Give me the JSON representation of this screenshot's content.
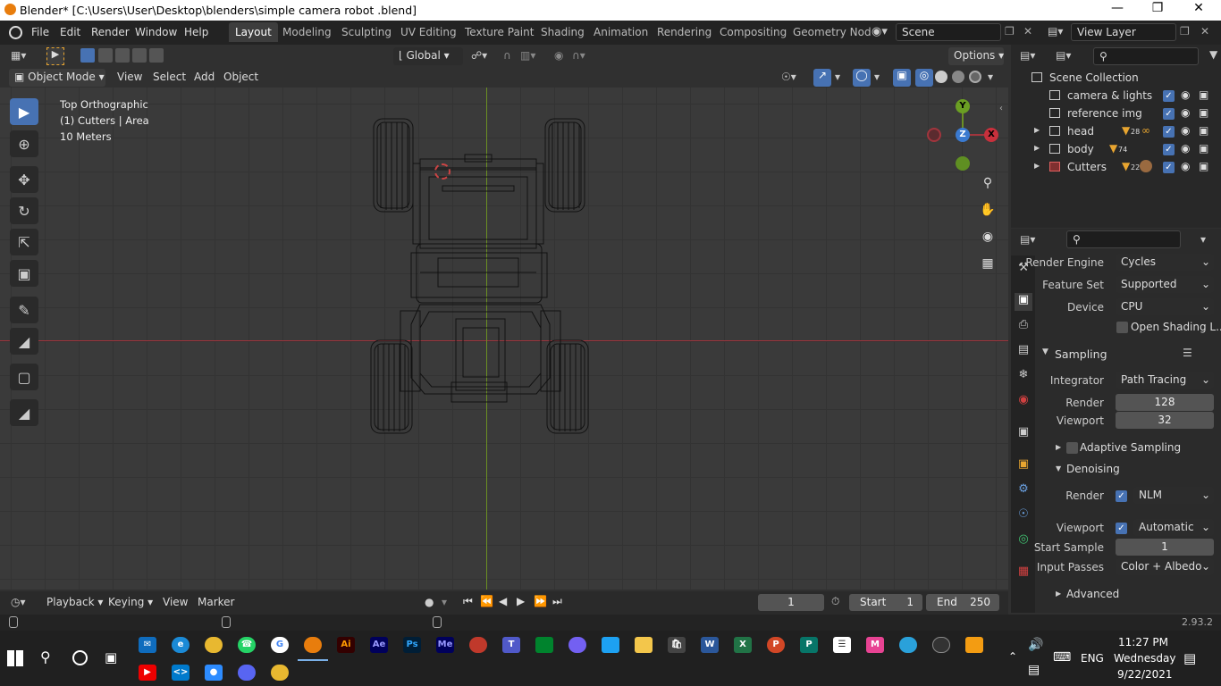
{
  "window": {
    "title": "Blender* [C:\\Users\\User\\Desktop\\blenders\\simple camera robot .blend]"
  },
  "menu": [
    "File",
    "Edit",
    "Render",
    "Window",
    "Help"
  ],
  "workspaces": [
    "Layout",
    "Modeling",
    "Sculpting",
    "UV Editing",
    "Texture Paint",
    "Shading",
    "Animation",
    "Rendering",
    "Compositing",
    "Geometry Nod"
  ],
  "scene": "Scene",
  "view_layer": "View Layer",
  "viewport": {
    "mode": "Object Mode",
    "menus": [
      "View",
      "Select",
      "Add",
      "Object"
    ],
    "orientation": "Global",
    "options": "Options",
    "info": [
      "Top Orthographic",
      "(1) Cutters | Area",
      "10 Meters"
    ],
    "gizmo": {
      "y": "Y",
      "z": "Z",
      "x": "X"
    }
  },
  "outliner": {
    "root": "Scene Collection",
    "items": [
      {
        "name": "camera & lights",
        "count": ""
      },
      {
        "name": "reference img",
        "count": ""
      },
      {
        "name": "head",
        "count": "28"
      },
      {
        "name": "body",
        "count": "74"
      },
      {
        "name": "Cutters",
        "count": "22"
      }
    ]
  },
  "properties": {
    "render_engine_label": "Render Engine",
    "render_engine": "Cycles",
    "feature_set_label": "Feature Set",
    "feature_set": "Supported",
    "device_label": "Device",
    "device": "CPU",
    "osl": "Open Shading L...",
    "sampling": "Sampling",
    "integrator_label": "Integrator",
    "integrator": "Path Tracing",
    "render_label": "Render",
    "render_samples": "128",
    "viewport_label": "Viewport",
    "viewport_samples": "32",
    "adaptive": "Adaptive Sampling",
    "denoising": "Denoising",
    "den_render_label": "Render",
    "den_render": "NLM",
    "den_viewport_label": "Viewport",
    "den_viewport": "Automatic",
    "start_sample_label": "Start Sample",
    "start_sample": "1",
    "input_passes_label": "Input Passes",
    "input_passes": "Color + Albedo",
    "advanced": "Advanced"
  },
  "timeline": {
    "menus": [
      "Playback",
      "Keying",
      "View",
      "Marker"
    ],
    "frame": "1",
    "start_label": "Start",
    "start": "1",
    "end_label": "End",
    "end": "250"
  },
  "status": {
    "version": "2.93.2"
  },
  "taskbar": {
    "time": "11:27 PM",
    "day": "Wednesday",
    "date": "9/22/2021",
    "lang": "ENG"
  }
}
